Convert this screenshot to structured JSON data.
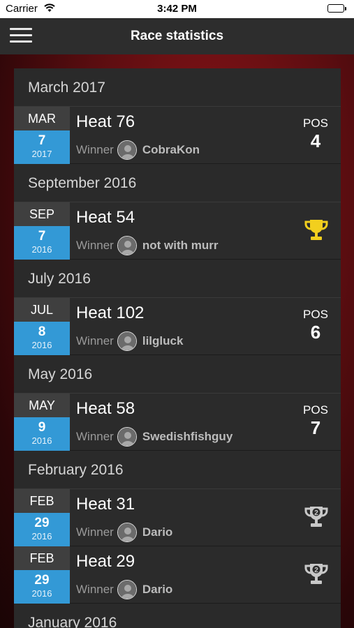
{
  "status_bar": {
    "carrier": "Carrier",
    "time": "3:42 PM"
  },
  "nav": {
    "title": "Race statistics"
  },
  "winner_label": "Winner",
  "pos_label": "POS",
  "colors": {
    "accent": "#3399d6",
    "gold": "#f2cf1e",
    "silver": "#c8c8c8"
  },
  "groups": [
    {
      "month": "March 2017",
      "races": [
        {
          "mon": "MAR",
          "day": "7",
          "year": "2017",
          "heat": "Heat 76",
          "winner": "CobraKon",
          "pos": "4",
          "trophy": null
        }
      ]
    },
    {
      "month": "September 2016",
      "races": [
        {
          "mon": "SEP",
          "day": "7",
          "year": "2016",
          "heat": "Heat 54",
          "winner": "not with murr",
          "pos": null,
          "trophy": "gold"
        }
      ]
    },
    {
      "month": "July 2016",
      "races": [
        {
          "mon": "JUL",
          "day": "8",
          "year": "2016",
          "heat": "Heat 102",
          "winner": "lilgluck",
          "pos": "6",
          "trophy": null
        }
      ]
    },
    {
      "month": "May 2016",
      "races": [
        {
          "mon": "MAY",
          "day": "9",
          "year": "2016",
          "heat": "Heat 58",
          "winner": "Swedishfishguy",
          "pos": "7",
          "trophy": null
        }
      ]
    },
    {
      "month": "February 2016",
      "races": [
        {
          "mon": "FEB",
          "day": "29",
          "year": "2016",
          "heat": "Heat 31",
          "winner": "Dario",
          "pos": null,
          "trophy": "silver-2"
        },
        {
          "mon": "FEB",
          "day": "29",
          "year": "2016",
          "heat": "Heat 29",
          "winner": "Dario",
          "pos": null,
          "trophy": "silver-2"
        }
      ]
    },
    {
      "month": "January 2016",
      "races": []
    }
  ]
}
